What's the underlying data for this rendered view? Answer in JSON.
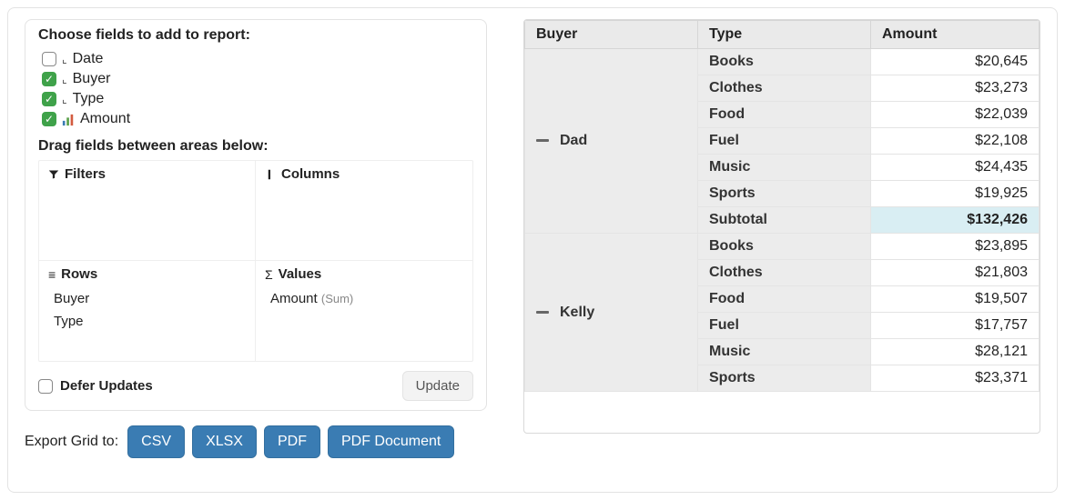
{
  "chooser": {
    "title": "Choose fields to add to report:",
    "fields": [
      {
        "checked": false,
        "icon": "dim",
        "label": "Date"
      },
      {
        "checked": true,
        "icon": "dim",
        "label": "Buyer"
      },
      {
        "checked": true,
        "icon": "dim",
        "label": "Type"
      },
      {
        "checked": true,
        "icon": "measure",
        "label": "Amount"
      }
    ]
  },
  "areas": {
    "title": "Drag fields between areas below:",
    "filters": {
      "label": "Filters",
      "items": []
    },
    "columns": {
      "label": "Columns",
      "items": []
    },
    "rows": {
      "label": "Rows",
      "items": [
        "Buyer",
        "Type"
      ]
    },
    "values": {
      "label": "Values",
      "items": [
        {
          "label": "Amount",
          "agg": "(Sum)"
        }
      ]
    }
  },
  "footer": {
    "defer_label": "Defer Updates",
    "defer_checked": false,
    "update_label": "Update"
  },
  "export": {
    "label": "Export Grid to:",
    "buttons": [
      "CSV",
      "XLSX",
      "PDF",
      "PDF Document"
    ]
  },
  "grid": {
    "headers": [
      "Buyer",
      "Type",
      "Amount"
    ],
    "groups": [
      {
        "buyer": "Dad",
        "rows": [
          {
            "type": "Books",
            "amount": "$20,645"
          },
          {
            "type": "Clothes",
            "amount": "$23,273"
          },
          {
            "type": "Food",
            "amount": "$22,039"
          },
          {
            "type": "Fuel",
            "amount": "$22,108"
          },
          {
            "type": "Music",
            "amount": "$24,435"
          },
          {
            "type": "Sports",
            "amount": "$19,925"
          }
        ],
        "subtotal": {
          "label": "Subtotal",
          "amount": "$132,426"
        }
      },
      {
        "buyer": "Kelly",
        "rows": [
          {
            "type": "Books",
            "amount": "$23,895"
          },
          {
            "type": "Clothes",
            "amount": "$21,803"
          },
          {
            "type": "Food",
            "amount": "$19,507"
          },
          {
            "type": "Fuel",
            "amount": "$17,757"
          },
          {
            "type": "Music",
            "amount": "$28,121"
          },
          {
            "type": "Sports",
            "amount": "$23,371"
          }
        ],
        "subtotal": null
      }
    ]
  }
}
